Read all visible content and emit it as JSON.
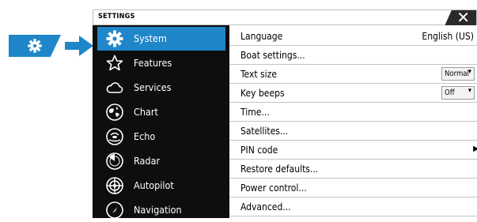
{
  "callout": {
    "icon": "gear-icon",
    "arrow": "right-arrow",
    "color": "#1f86c9"
  },
  "window": {
    "title": "SETTINGS",
    "close_icon": "close-icon",
    "close_symbol": "✕"
  },
  "sidebar": {
    "accent": "#1f86c9",
    "items": [
      {
        "label": "System",
        "icon": "gear-icon",
        "selected": true
      },
      {
        "label": "Features",
        "icon": "star-icon",
        "selected": false
      },
      {
        "label": "Services",
        "icon": "cloud-icon",
        "selected": false
      },
      {
        "label": "Chart",
        "icon": "chart-icon",
        "selected": false
      },
      {
        "label": "Echo",
        "icon": "echo-icon",
        "selected": false
      },
      {
        "label": "Radar",
        "icon": "radar-icon",
        "selected": false
      },
      {
        "label": "Autopilot",
        "icon": "steering-wheel-icon",
        "selected": false
      },
      {
        "label": "Navigation",
        "icon": "compass-icon",
        "selected": false
      }
    ]
  },
  "settings": {
    "rows": [
      {
        "label": "Language",
        "value": "English (US)"
      },
      {
        "label": "Boat settings..."
      },
      {
        "label": "Text size",
        "dropdown": "Normal",
        "caret": "▾"
      },
      {
        "label": "Key beeps",
        "dropdown": "Off",
        "caret": "▾"
      },
      {
        "label": "Time..."
      },
      {
        "label": "Satellites..."
      },
      {
        "label": "PIN code",
        "chevron": "▶"
      },
      {
        "label": "Restore defaults..."
      },
      {
        "label": "Power control..."
      },
      {
        "label": "Advanced..."
      }
    ]
  }
}
